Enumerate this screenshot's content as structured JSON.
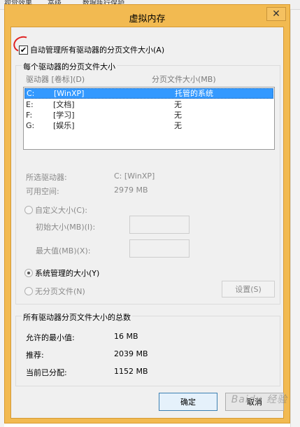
{
  "background": {
    "tabs": [
      "视觉效果",
      "高级",
      "数据执行保护"
    ]
  },
  "window": {
    "title": "虚拟内存",
    "close_glyph": "✕"
  },
  "auto_manage": {
    "label": "自动管理所有驱动器的分页文件大小(A)",
    "checked": true,
    "check_glyph": "✔"
  },
  "per_drive": {
    "group_title": "每个驱动器的分页文件大小",
    "columns": [
      "驱动器 [卷标](D)",
      "分页文件大小(MB)"
    ],
    "rows": [
      {
        "drive": "C:",
        "label": "[WinXP]",
        "size": "托管的系统",
        "selected": true
      },
      {
        "drive": "E:",
        "label": "[文档]",
        "size": "无",
        "selected": false
      },
      {
        "drive": "F:",
        "label": "[学习]",
        "size": "无",
        "selected": false
      },
      {
        "drive": "G:",
        "label": "[娱乐]",
        "size": "无",
        "selected": false
      }
    ],
    "selected_drive_label": "所选驱动器:",
    "selected_drive_value": "C:  [WinXP]",
    "free_space_label": "可用空间:",
    "free_space_value": "2979 MB",
    "custom_size_label": "自定义大小(C):",
    "initial_size_label": "初始大小(MB)(I):",
    "max_size_label": "最大值(MB)(X):",
    "system_managed_label": "系统管理的大小(Y)",
    "no_paging_label": "无分页文件(N)",
    "set_button": "设置(S)"
  },
  "totals": {
    "group_title": "所有驱动器分页文件大小的总数",
    "min_label": "允许的最小值:",
    "min_value": "16 MB",
    "recommended_label": "推荐:",
    "recommended_value": "2039 MB",
    "current_label": "当前已分配:",
    "current_value": "1152 MB"
  },
  "buttons": {
    "ok": "确定",
    "cancel": "取消"
  },
  "watermark": "Baidu 经验",
  "colors": {
    "window_frame": "#f2ba51",
    "selection": "#3399ff",
    "annotation": "#e02020"
  }
}
